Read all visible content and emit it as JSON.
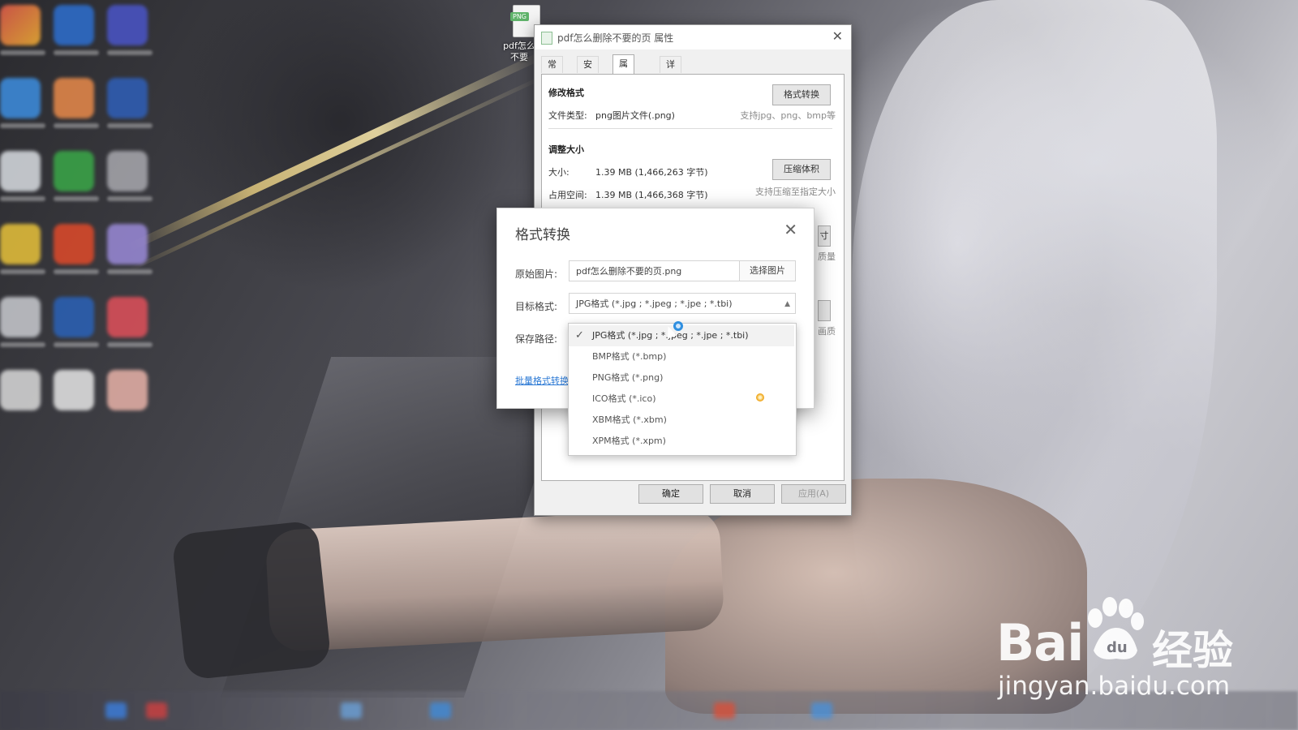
{
  "desktop": {
    "file_badge": "PNG",
    "file_label_line1": "pdf怎么",
    "file_label_line2": "不要"
  },
  "properties_window": {
    "title": "pdf怎么删除不要的页 属性",
    "tabs": [
      "常规",
      "安全",
      "属性修改",
      "详细信息"
    ],
    "active_tab": "属性修改",
    "modify_format": {
      "section_title": "修改格式",
      "file_type_label": "文件类型:",
      "file_type_value": "png图片文件(.png)",
      "button": "格式转换",
      "hint": "支持jpg、png、bmp等"
    },
    "adjust_size": {
      "section_title": "调整大小",
      "size_label": "大小:",
      "size_value": "1.39 MB (1,466,263 字节)",
      "disk_label": "占用空间:",
      "disk_value": "1.39 MB (1,466,368 字节)",
      "button": "压缩体积",
      "hint": "支持压缩至指定大小"
    },
    "partial_hint_1": "质量",
    "partial_hint_2": "画质",
    "partial_button": "寸",
    "ok": "确定",
    "cancel": "取消",
    "apply": "应用(A)"
  },
  "convert_dialog": {
    "title": "格式转换",
    "source_label": "原始图片:",
    "source_value": "pdf怎么删除不要的页.png",
    "select_button": "选择图片",
    "target_label": "目标格式:",
    "target_value": "JPG格式 (*.jpg ; *.jpeg ; *.jpe ; *.tbi)",
    "save_label": "保存路径:",
    "batch_link": "批量格式转换"
  },
  "format_options": [
    {
      "label": "JPG格式 (*.jpg ; *.jpeg ; *.jpe ; *.tbi)",
      "selected": true
    },
    {
      "label": "BMP格式 (*.bmp)",
      "selected": false
    },
    {
      "label": "PNG格式 (*.png)",
      "selected": false
    },
    {
      "label": "ICO格式 (*.ico)",
      "selected": false
    },
    {
      "label": "XBM格式 (*.xbm)",
      "selected": false
    },
    {
      "label": "XPM格式 (*.xpm)",
      "selected": false
    }
  ],
  "watermark": {
    "brand": "Bai",
    "brand_suffix": "经验",
    "url": "jingyan.baidu.com"
  },
  "colors": {
    "link": "#2a78d4",
    "accent_busy": "#2f8fe0"
  }
}
